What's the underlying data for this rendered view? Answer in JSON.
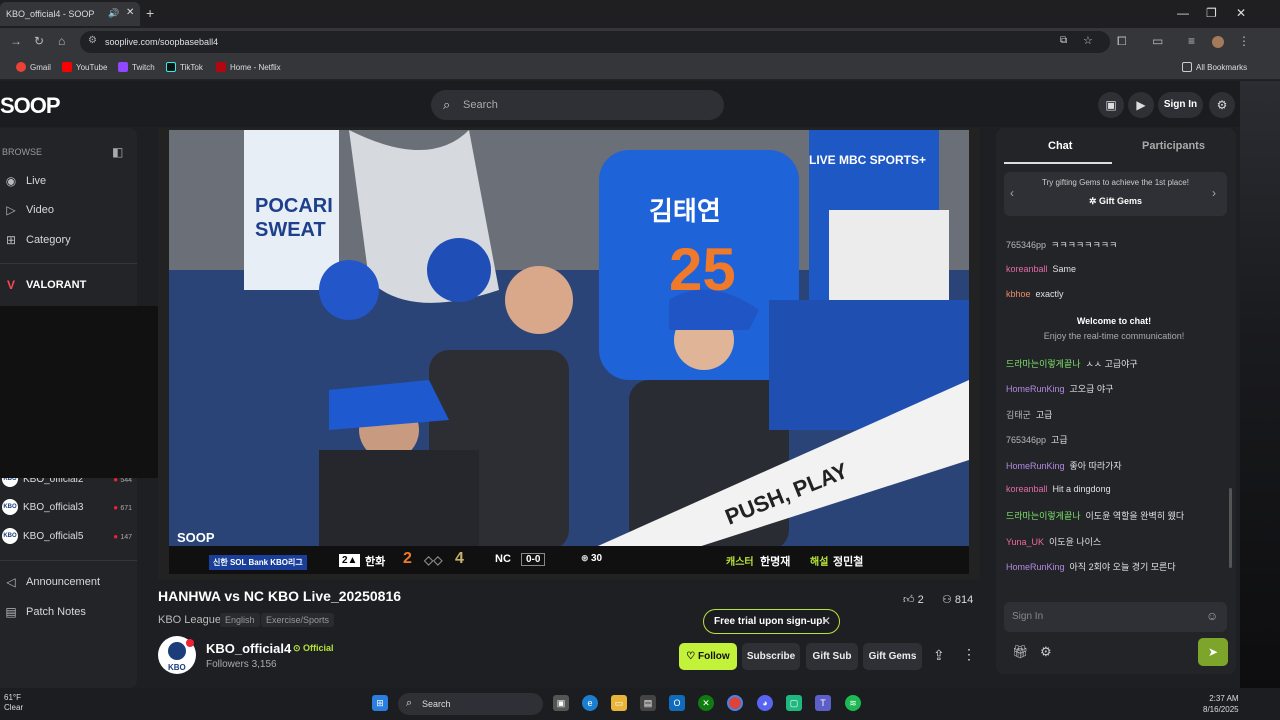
{
  "browser": {
    "tab_title": "KBO_official4 - SOOP",
    "url": "sooplive.com/soopbaseball4",
    "bookmarks": [
      "Gmail",
      "YouTube",
      "Twitch",
      "TikTok",
      "Home - Netflix"
    ],
    "all_bookmarks": "All Bookmarks"
  },
  "site": {
    "logo": "SOOP",
    "search_placeholder": "Search",
    "sign_in": "Sign In"
  },
  "sidebar": {
    "browse": "BROWSE",
    "nav": [
      "Live",
      "Video",
      "Category"
    ],
    "featured": "VALORANT",
    "channels": [
      {
        "name": "KBO_official2",
        "count": "544"
      },
      {
        "name": "KBO_official3",
        "count": "671"
      },
      {
        "name": "KBO_official5",
        "count": "147"
      }
    ],
    "footer": [
      "Announcement",
      "Patch Notes"
    ]
  },
  "video": {
    "jersey_name": "김태연",
    "jersey_number": "25",
    "broadcaster": "LIVE MBC SPORTS+",
    "sponsor": "POCARI SWEAT",
    "banner": "PUSH, PLAY",
    "watermark": "SOOP",
    "scoreboard": {
      "league": "신한 SOL Bank KBO리그",
      "inning": "2▲",
      "team_away": "한화",
      "score_away": "2",
      "score_home": "4",
      "team_home": "NC",
      "count": "0-0",
      "pitch_count": "30",
      "caster_label": "캐스터",
      "caster": "한명재",
      "analyst_label": "해설",
      "analyst": "정민철"
    }
  },
  "stream": {
    "title": "HANHWA vs NC KBO Live_20250816",
    "category": "KBO League",
    "tags": [
      "English",
      "Exercise/Sports"
    ],
    "likes": "2",
    "viewers": "814",
    "channel": "KBO_official4",
    "official": "Official",
    "followers": "Followers 3,156",
    "free_trial": "Free trial upon sign-up!",
    "buttons": {
      "follow": "Follow",
      "subscribe": "Subscribe",
      "gift_sub": "Gift Sub",
      "gift_gems": "Gift Gems"
    }
  },
  "chat": {
    "tabs": [
      "Chat",
      "Participants"
    ],
    "gems_text": "Try gifting Gems to achieve the 1st place!",
    "gems_button": "Gift Gems",
    "welcome": "Welcome to chat!",
    "welcome_sub": "Enjoy the real-time communication!",
    "messages_top": [
      {
        "user": "765346pp",
        "text": "ㅋㅋㅋㅋㅋㅋㅋㅋ",
        "color": "#b9b9b9"
      },
      {
        "user": "koreanball",
        "text": "Same",
        "color": "#e36ba8"
      },
      {
        "user": "kbhoe",
        "text": "exactly",
        "color": "#f08a6a"
      }
    ],
    "messages": [
      {
        "user": "드라마는이렇게끝나",
        "text": "ㅅㅅ 고급야구",
        "color": "#7ce36b"
      },
      {
        "user": "HomeRunKing",
        "text": "고오급 야구",
        "color": "#b28ae0"
      },
      {
        "user": "김태군",
        "text": "고급",
        "color": "#b9b9b9"
      },
      {
        "user": "765346pp",
        "text": "고급",
        "color": "#b9b9b9"
      },
      {
        "user": "HomeRunKing",
        "text": "좋아 따라가자",
        "color": "#b28ae0"
      },
      {
        "user": "koreanball",
        "text": "Hit a dingdong",
        "color": "#e36ba8"
      },
      {
        "user": "드라마는이렇게끝나",
        "text": "이도윤 역할을 완벽히 웼다",
        "color": "#7ce36b"
      },
      {
        "user": "Yuna_UK",
        "text": "이도윤 나이스",
        "color": "#f06a9a"
      },
      {
        "user": "HomeRunKing",
        "text": "아직 2회야 오늘 경기 모른다",
        "color": "#b28ae0"
      }
    ],
    "input_placeholder": "Sign In"
  },
  "taskbar": {
    "temp": "61°F",
    "weather": "Clear",
    "search": "Search",
    "time": "2:37 AM",
    "date": "8/16/2025"
  },
  "colors": {
    "accent": "#c2f23a",
    "bg": "#1b1c1f"
  }
}
